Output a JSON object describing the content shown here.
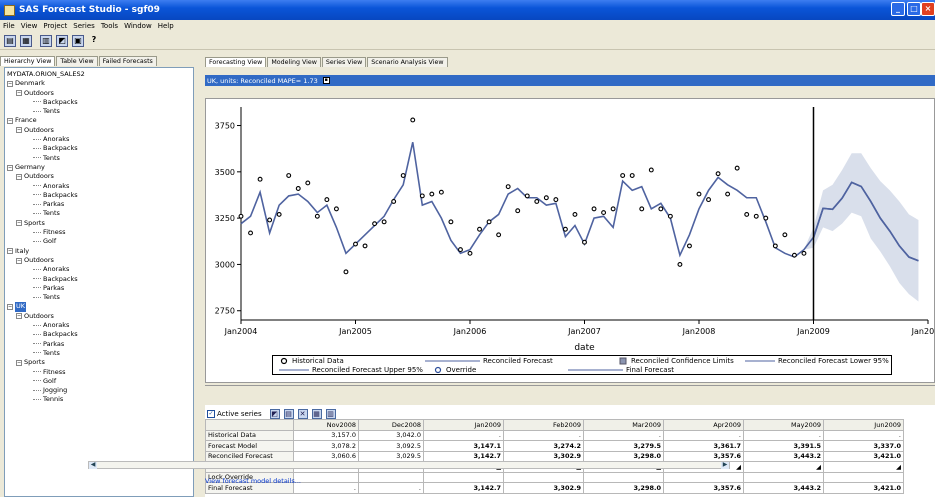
{
  "window": {
    "title": "SAS Forecast Studio - sgf09"
  },
  "menu": [
    "File",
    "View",
    "Project",
    "Series",
    "Tools",
    "Window",
    "Help"
  ],
  "toolbar_icons": [
    "new-project-icon",
    "open-project-icon",
    "series-icon",
    "chart-icon",
    "save-icon",
    "help-icon"
  ],
  "help_glyph": "?",
  "left_tabs": [
    "Hierarchy View",
    "Table View",
    "Failed Forecasts"
  ],
  "tree": [
    {
      "label": "MYDATA.ORION_SALES2",
      "level": 0,
      "type": "root"
    },
    {
      "label": "Denmark",
      "level": 0,
      "type": "node"
    },
    {
      "label": "Outdoors",
      "level": 1,
      "type": "node"
    },
    {
      "label": "Backpacks",
      "level": 2,
      "type": "leaf"
    },
    {
      "label": "Tents",
      "level": 2,
      "type": "leaf"
    },
    {
      "label": "France",
      "level": 0,
      "type": "node"
    },
    {
      "label": "Outdoors",
      "level": 1,
      "type": "node"
    },
    {
      "label": "Anoraks",
      "level": 2,
      "type": "leaf"
    },
    {
      "label": "Backpacks",
      "level": 2,
      "type": "leaf"
    },
    {
      "label": "Tents",
      "level": 2,
      "type": "leaf"
    },
    {
      "label": "Germany",
      "level": 0,
      "type": "node"
    },
    {
      "label": "Outdoors",
      "level": 1,
      "type": "node"
    },
    {
      "label": "Anoraks",
      "level": 2,
      "type": "leaf"
    },
    {
      "label": "Backpacks",
      "level": 2,
      "type": "leaf"
    },
    {
      "label": "Parkas",
      "level": 2,
      "type": "leaf"
    },
    {
      "label": "Tents",
      "level": 2,
      "type": "leaf"
    },
    {
      "label": "Sports",
      "level": 1,
      "type": "node"
    },
    {
      "label": "Fitness",
      "level": 2,
      "type": "leaf"
    },
    {
      "label": "Golf",
      "level": 2,
      "type": "leaf"
    },
    {
      "label": "Italy",
      "level": 0,
      "type": "node"
    },
    {
      "label": "Outdoors",
      "level": 1,
      "type": "node"
    },
    {
      "label": "Anoraks",
      "level": 2,
      "type": "leaf"
    },
    {
      "label": "Backpacks",
      "level": 2,
      "type": "leaf"
    },
    {
      "label": "Parkas",
      "level": 2,
      "type": "leaf"
    },
    {
      "label": "Tents",
      "level": 2,
      "type": "leaf"
    },
    {
      "label": "UK",
      "level": 0,
      "type": "node",
      "selected": true
    },
    {
      "label": "Outdoors",
      "level": 1,
      "type": "node"
    },
    {
      "label": "Anoraks",
      "level": 2,
      "type": "leaf"
    },
    {
      "label": "Backpacks",
      "level": 2,
      "type": "leaf"
    },
    {
      "label": "Parkas",
      "level": 2,
      "type": "leaf"
    },
    {
      "label": "Tents",
      "level": 2,
      "type": "leaf"
    },
    {
      "label": "Sports",
      "level": 1,
      "type": "node"
    },
    {
      "label": "Fitness",
      "level": 2,
      "type": "leaf"
    },
    {
      "label": "Golf",
      "level": 2,
      "type": "leaf"
    },
    {
      "label": "Jogging",
      "level": 2,
      "type": "leaf"
    },
    {
      "label": "Tennis",
      "level": 2,
      "type": "leaf"
    }
  ],
  "view_tabs": [
    "Forecasting View",
    "Modeling View",
    "Series View",
    "Scenario Analysis View"
  ],
  "mape_bar": "UK, units: Reconciled MAPE= 1.73",
  "chart_data": {
    "type": "line",
    "xlabel": "date",
    "ylabel": "",
    "x_ticks": [
      "Jan2004",
      "Jan2005",
      "Jan2006",
      "Jan2007",
      "Jan2008",
      "Jan2009",
      "Jan2010"
    ],
    "y_ticks": [
      2750,
      3000,
      3250,
      3500,
      3750
    ],
    "ylim": [
      2700,
      3850
    ],
    "forecast_start": "Jan2009",
    "series": [
      {
        "name": "Historical Data",
        "kind": "points",
        "t": [
          0,
          1,
          2,
          3,
          4,
          5,
          6,
          7,
          8,
          9,
          10,
          11,
          12,
          13,
          14,
          15,
          16,
          17,
          18,
          19,
          20,
          21,
          22,
          23,
          24,
          25,
          26,
          27,
          28,
          29,
          30,
          31,
          32,
          33,
          34,
          35,
          36,
          37,
          38,
          39,
          40,
          41,
          42,
          43,
          44,
          45,
          46,
          47,
          48,
          49,
          50,
          51,
          52,
          53,
          54,
          55,
          56,
          57,
          58,
          59
        ],
        "values": [
          3260,
          3170,
          3460,
          3240,
          3270,
          3480,
          3410,
          3440,
          3260,
          3350,
          3300,
          2960,
          3110,
          3100,
          3220,
          3230,
          3340,
          3480,
          3780,
          3370,
          3380,
          3390,
          3230,
          3080,
          3060,
          3190,
          3230,
          3160,
          3420,
          3290,
          3370,
          3340,
          3360,
          3350,
          3190,
          3270,
          3120,
          3300,
          3280,
          3300,
          3480,
          3480,
          3300,
          3510,
          3300,
          3260,
          3000,
          3100,
          3380,
          3350,
          3490,
          3380,
          3520,
          3270,
          3260,
          3250,
          3100,
          3160,
          3050,
          3060
        ]
      },
      {
        "name": "Reconciled Forecast",
        "kind": "line",
        "t": [
          0,
          1,
          2,
          3,
          4,
          5,
          6,
          7,
          8,
          9,
          10,
          11,
          12,
          13,
          14,
          15,
          16,
          17,
          18,
          19,
          20,
          21,
          22,
          23,
          24,
          25,
          26,
          27,
          28,
          29,
          30,
          31,
          32,
          33,
          34,
          35,
          36,
          37,
          38,
          39,
          40,
          41,
          42,
          43,
          44,
          45,
          46,
          47,
          48,
          49,
          50,
          51,
          52,
          53,
          54,
          55,
          56,
          57,
          58,
          59,
          60,
          61,
          62,
          63,
          64,
          65,
          66,
          67,
          68,
          69,
          70,
          71
        ],
        "values": [
          3220,
          3260,
          3390,
          3170,
          3320,
          3370,
          3380,
          3340,
          3280,
          3320,
          3200,
          3060,
          3110,
          3160,
          3210,
          3260,
          3350,
          3430,
          3660,
          3320,
          3340,
          3250,
          3130,
          3060,
          3080,
          3160,
          3230,
          3270,
          3380,
          3410,
          3360,
          3360,
          3320,
          3330,
          3150,
          3210,
          3110,
          3250,
          3260,
          3200,
          3450,
          3400,
          3420,
          3300,
          3330,
          3250,
          3050,
          3160,
          3300,
          3400,
          3470,
          3430,
          3400,
          3360,
          3360,
          3230,
          3090,
          3060,
          3040,
          3080,
          3147.1,
          3302.9,
          3298.0,
          3357.6,
          3443.2,
          3421.0,
          3340,
          3250,
          3180,
          3100,
          3040,
          3020
        ]
      },
      {
        "name": "Final Forecast",
        "kind": "line",
        "t": [
          60,
          61,
          62,
          63,
          64,
          65,
          66,
          67,
          68,
          69,
          70,
          71
        ],
        "values": [
          3142.7,
          3302.9,
          3298.0,
          3357.6,
          3443.2,
          3421.0,
          3340,
          3250,
          3180,
          3100,
          3040,
          3020
        ]
      },
      {
        "name": "Reconciled Forecast Upper 95%",
        "kind": "band-upper",
        "t": [
          59,
          60,
          61,
          62,
          63,
          64,
          65,
          66,
          67,
          68,
          69,
          70,
          71
        ],
        "values": [
          3080,
          3200,
          3400,
          3430,
          3510,
          3600,
          3600,
          3520,
          3450,
          3400,
          3340,
          3270,
          3240
        ]
      },
      {
        "name": "Reconciled Forecast Lower 95%",
        "kind": "band-lower",
        "t": [
          59,
          60,
          61,
          62,
          63,
          64,
          65,
          66,
          67,
          68,
          69,
          70,
          71
        ],
        "values": [
          3080,
          3090,
          3200,
          3180,
          3220,
          3280,
          3260,
          3140,
          3070,
          2990,
          2900,
          2840,
          2800
        ]
      }
    ],
    "legend": [
      {
        "label": "Historical Data",
        "symbol": "circle"
      },
      {
        "label": "Reconciled Forecast",
        "symbol": "line"
      },
      {
        "label": "Reconciled Confidence Limits",
        "symbol": "square"
      },
      {
        "label": "Reconciled Forecast Lower 95%",
        "symbol": "line"
      },
      {
        "label": "Reconciled Forecast Upper 95%",
        "symbol": "line"
      },
      {
        "label": "Override",
        "symbol": "circle-blue"
      },
      {
        "label": "Final Forecast",
        "symbol": "line"
      }
    ],
    "colors": {
      "line": "#4f63a0",
      "band": "#d9dfeb",
      "marker": "#000000",
      "override": "#2b4c9a"
    }
  },
  "table_toolbar": {
    "active_series": "Active series"
  },
  "table": {
    "columns": [
      "Nov2008",
      "Dec2008",
      "Jan2009",
      "Feb2009",
      "Mar2009",
      "Apr2009",
      "May2009",
      "Jun2009"
    ],
    "rows": [
      {
        "label": "Historical Data",
        "cells": [
          "3,157.0",
          "3,042.0",
          ".",
          ".",
          ".",
          ".",
          ".",
          "."
        ],
        "bold_from": 99
      },
      {
        "label": "Forecast Model",
        "cells": [
          "3,078.2",
          "3,092.5",
          "3,147.1",
          "3,274.2",
          "3,279.5",
          "3,361.7",
          "3,391.5",
          "3,337.0"
        ],
        "bold_from": 2
      },
      {
        "label": "Reconciled Forecast",
        "cells": [
          "3,060.6",
          "3,029.5",
          "3,142.7",
          "3,302.9",
          "3,298.0",
          "3,357.6",
          "3,443.2",
          "3,421.0"
        ],
        "bold_from": 2
      },
      {
        "label": "Override",
        "cells": [
          "",
          "",
          "◢",
          "◢",
          "◢",
          "◢",
          "◢",
          "◢"
        ],
        "bold_from": 99
      },
      {
        "label": "Lock Override",
        "cells": [
          "",
          "",
          "",
          "",
          "",
          "",
          "",
          ""
        ],
        "bold_from": 99
      },
      {
        "label": "Final Forecast",
        "cells": [
          ".",
          ".",
          "3,142.7",
          "3,302.9",
          "3,298.0",
          "3,357.6",
          "3,443.2",
          "3,421.0"
        ],
        "bold_from": 2
      }
    ]
  },
  "model_link": "View forecast model details..."
}
